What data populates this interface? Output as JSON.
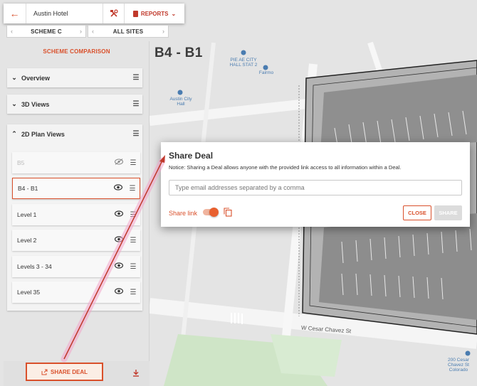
{
  "topbar": {
    "deal_name": "Austin Hotel",
    "reports_label": "REPORTS"
  },
  "selectors": {
    "scheme": "SCHEME C",
    "sites": "ALL SITES"
  },
  "panel": {
    "title": "SCHEME COMPARISON",
    "sections": [
      {
        "label": "Overview"
      },
      {
        "label": "3D Views"
      },
      {
        "label": "2D Plan Views"
      }
    ],
    "levels": [
      {
        "label": "B5",
        "visible": false
      },
      {
        "label": "B4 - B1",
        "visible": true,
        "selected": true
      },
      {
        "label": "Level 1",
        "visible": true
      },
      {
        "label": "Level 2",
        "visible": true
      },
      {
        "label": "Levels 3 - 34",
        "visible": true
      },
      {
        "label": "Level 35",
        "visible": true
      }
    ],
    "share_deal_label": "SHARE DEAL"
  },
  "map": {
    "title": "B4 - B1",
    "labels": {
      "plaza": "PIE AE CITY\nHALL STAT 2",
      "fairmont": "Fairmo",
      "city_hall": "Austin City Hall",
      "chavez": "W Cesar Chavez St",
      "bottom_right": "200 Cesar Chavez St\nColorado"
    }
  },
  "dialog": {
    "title": "Share Deal",
    "notice": "Notice: Sharing a Deal allows anyone with the provided link access to all information within a Deal.",
    "email_placeholder": "Type email addresses separated by a comma",
    "share_link_label": "Share link",
    "share_link_enabled": true,
    "close_label": "CLOSE",
    "share_label": "SHARE"
  },
  "colors": {
    "accent": "#d9502b",
    "annotation_arrow": "#c0392b"
  },
  "icons": {
    "back": "arrow-left-icon",
    "tools": "tools-icon",
    "reports": "document-icon",
    "eye": "eye-icon",
    "eye_off": "eye-off-icon",
    "drag": "drag-handle-icon",
    "share": "share-icon",
    "download": "download-icon",
    "copy": "copy-icon"
  }
}
